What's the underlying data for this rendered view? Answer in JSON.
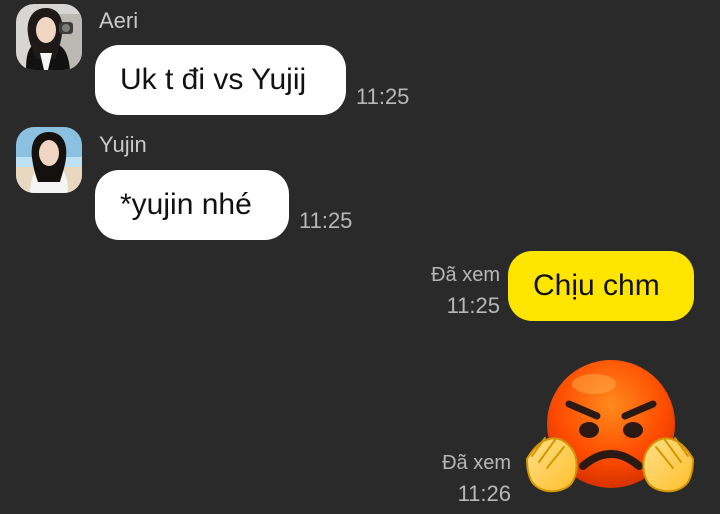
{
  "messages": [
    {
      "sender": "Aeri",
      "text": "Uk t đi vs Yujij",
      "time": "11:25"
    },
    {
      "sender": "Yujin",
      "text": "*yujin nhé",
      "time": "11:25"
    },
    {
      "text": "Chịu chm",
      "status": "Đã xem",
      "time": "11:25"
    },
    {
      "sticker": "angry-face-emoji",
      "status": "Đã xem",
      "time": "11:26"
    }
  ],
  "colors": {
    "background": "#2a2a2a",
    "incoming_bubble": "#ffffff",
    "outgoing_bubble": "#fee500",
    "muted_text": "#b7b7b7"
  }
}
